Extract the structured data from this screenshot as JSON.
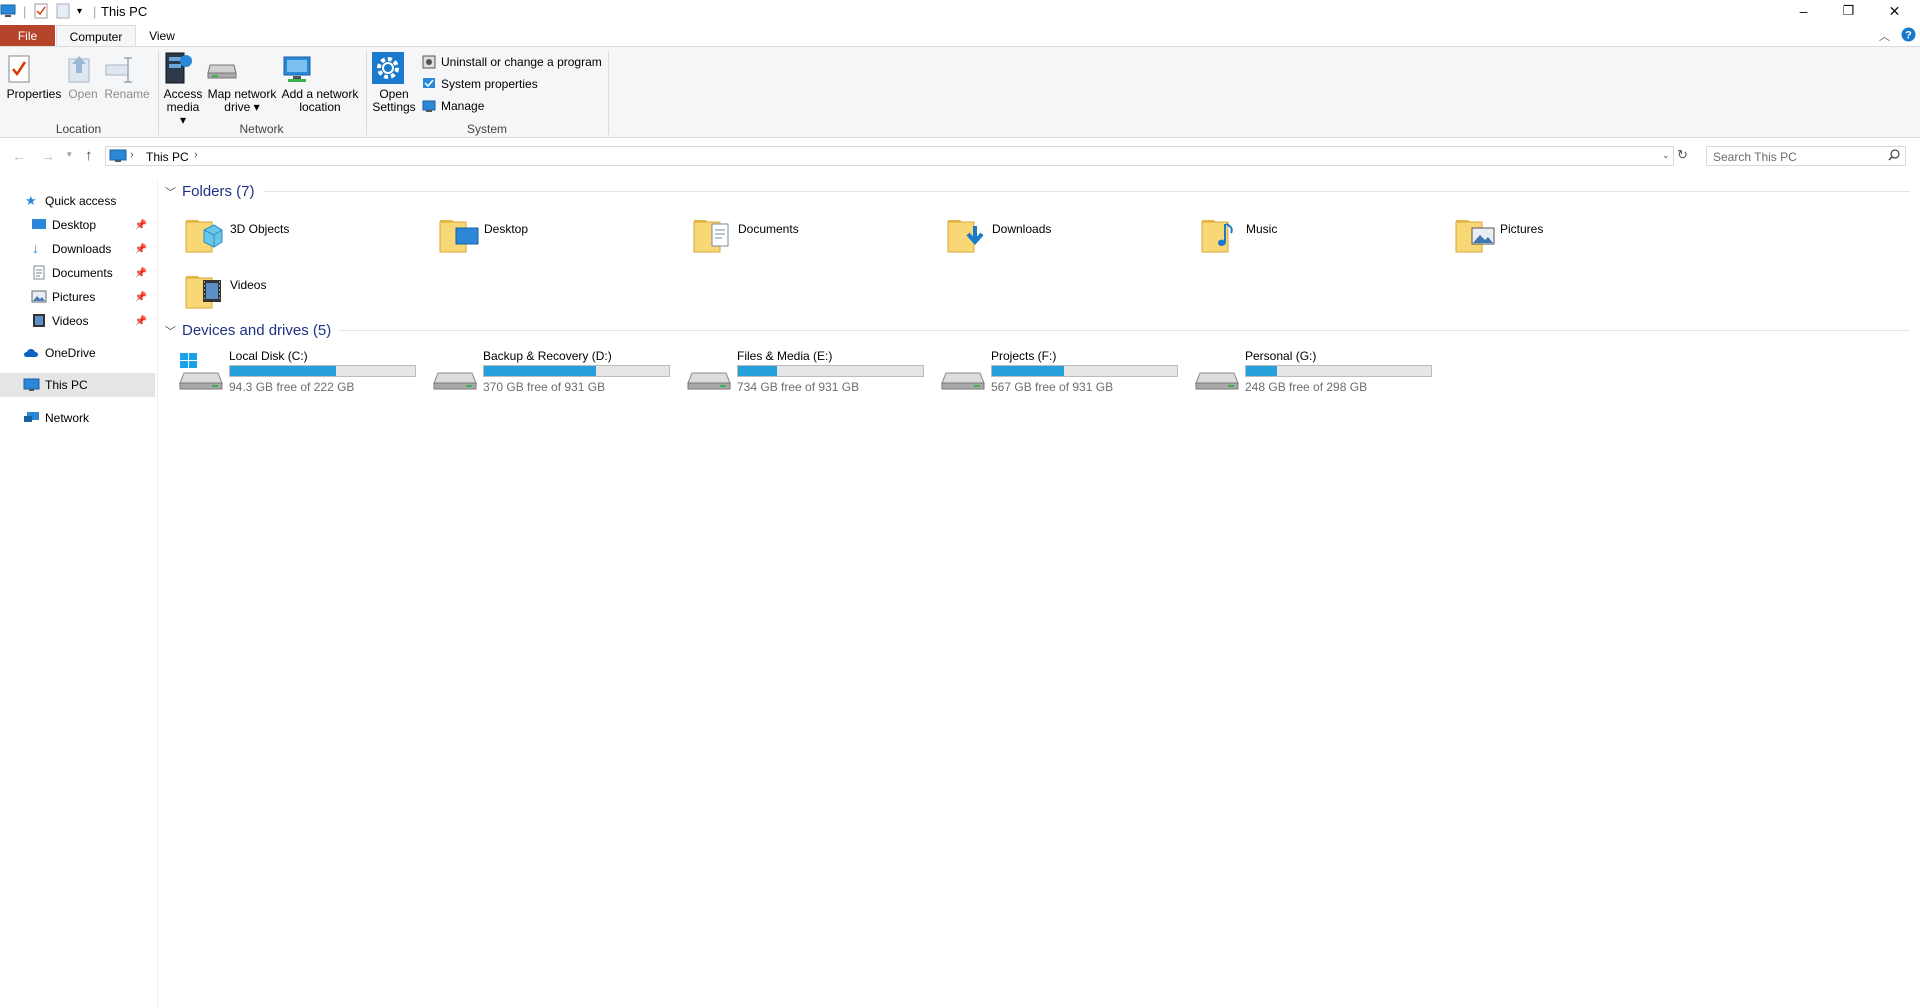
{
  "window": {
    "title": "This PC",
    "controls": {
      "minimize": "–",
      "restore": "❐",
      "close": "✕"
    }
  },
  "ribbon": {
    "tabs": [
      {
        "label": "File"
      },
      {
        "label": "Computer"
      },
      {
        "label": "View"
      }
    ],
    "location": {
      "group_label": "Location",
      "properties": "Properties",
      "open": "Open",
      "rename": "Rename"
    },
    "network": {
      "group_label": "Network",
      "access_media_1": "Access",
      "access_media_2": "media",
      "map_drive_1": "Map network",
      "map_drive_2": "drive",
      "add_location_1": "Add a network",
      "add_location_2": "location"
    },
    "system": {
      "group_label": "System",
      "open_settings_1": "Open",
      "open_settings_2": "Settings",
      "uninstall": "Uninstall or change a program",
      "system_properties": "System properties",
      "manage": "Manage"
    }
  },
  "addressbar": {
    "crumbs": [
      "This PC"
    ],
    "search_placeholder": "Search This PC"
  },
  "navpane": {
    "quick_access": "Quick access",
    "pinned": [
      "Desktop",
      "Downloads",
      "Documents",
      "Pictures",
      "Videos"
    ],
    "onedrive": "OneDrive",
    "this_pc": "This PC",
    "network": "Network"
  },
  "content": {
    "folders_header": "Folders (7)",
    "folders": [
      "3D Objects",
      "Desktop",
      "Documents",
      "Downloads",
      "Music",
      "Pictures",
      "Videos"
    ],
    "drives_header": "Devices and drives (5)",
    "drives": [
      {
        "name": "Local Disk (C:)",
        "free": "94.3 GB free of 222 GB",
        "used_fraction": 0.575
      },
      {
        "name": "Backup & Recovery (D:)",
        "free": "370 GB free of 931 GB",
        "used_fraction": 0.603
      },
      {
        "name": "Files & Media (E:)",
        "free": "734 GB free of 931 GB",
        "used_fraction": 0.212
      },
      {
        "name": "Projects (F:)",
        "free": "567 GB free of 931 GB",
        "used_fraction": 0.391
      },
      {
        "name": "Personal (G:)",
        "free": "248 GB free of 298 GB",
        "used_fraction": 0.168
      }
    ]
  },
  "colors": {
    "accent": "#26a0da",
    "file_tab": "#b5442a",
    "header_blue": "#1e3287",
    "folder_yellow": "#f8d775"
  }
}
